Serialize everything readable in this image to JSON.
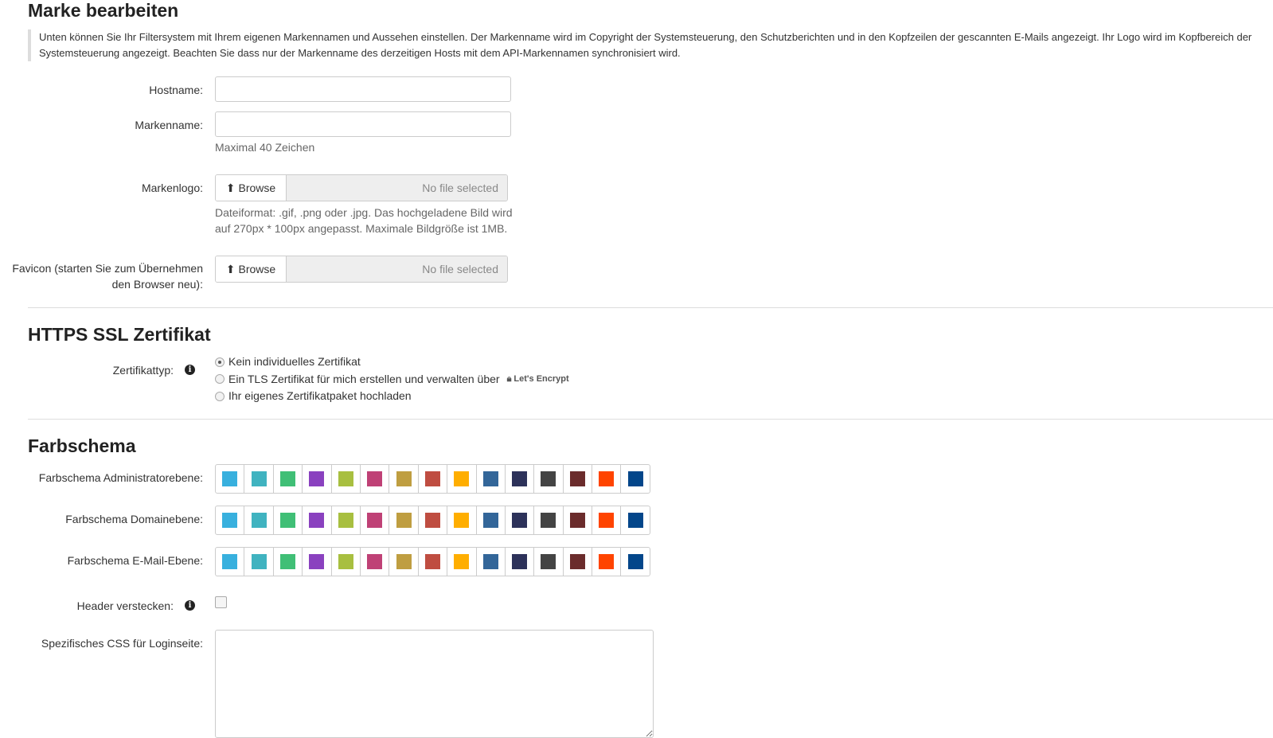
{
  "brand": {
    "title": "Marke bearbeiten",
    "intro": "Unten können Sie Ihr Filtersystem mit Ihrem eigenen Markennamen und Aussehen einstellen. Der Markenname wird im Copyright der Systemsteuerung, den Schutzberichten und in den Kopfzeilen der gescannten E-Mails angezeigt. Ihr Logo wird im Kopfbereich der Systemsteuerung angezeigt. Beachten Sie dass nur der Markenname des derzeitigen Hosts mit dem API-Markennamen synchronisiert wird.",
    "hostname_label": "Hostname:",
    "hostname_value": "",
    "brandname_label": "Markenname:",
    "brandname_value": "",
    "brandname_help": "Maximal 40 Zeichen",
    "logo_label": "Markenlogo:",
    "browse": "Browse",
    "no_file": "No file selected",
    "logo_help_1": "Dateiformat: .gif, .png oder .jpg. Das hochgeladene Bild wird",
    "logo_help_2": "auf 270px * 100px angepasst. Maximale Bildgröße ist 1MB.",
    "favicon_label_1": "Favicon (starten Sie zum Übernehmen",
    "favicon_label_2": "den Browser neu):"
  },
  "ssl": {
    "title": "HTTPS SSL Zertifikat",
    "type_label": "Zertifikattyp:",
    "options": [
      "Kein individuelles Zertifikat",
      "Ein TLS Zertifikat für mich erstellen und verwalten über",
      "Ihr eigenes Zertifikatpaket hochladen"
    ],
    "selected": 0,
    "letsencrypt": "Let's Encrypt"
  },
  "scheme": {
    "title": "Farbschema",
    "rows": [
      "Farbschema Administratorebene:",
      "Farbschema Domainebene:",
      "Farbschema E-Mail-Ebene:"
    ],
    "colors": [
      "#38b0de",
      "#40b3c0",
      "#40bf76",
      "#8a41bf",
      "#a8bf40",
      "#bf4176",
      "#bf9e41",
      "#bf4d41",
      "#ffae00",
      "#336699",
      "#2d325a",
      "#444444",
      "#6b2c2c",
      "#ff4400",
      "#03468a"
    ],
    "hide_header_label": "Header verstecken:",
    "hide_header": false,
    "css_label": "Spezifisches CSS für Loginseite:",
    "css_value": ""
  }
}
